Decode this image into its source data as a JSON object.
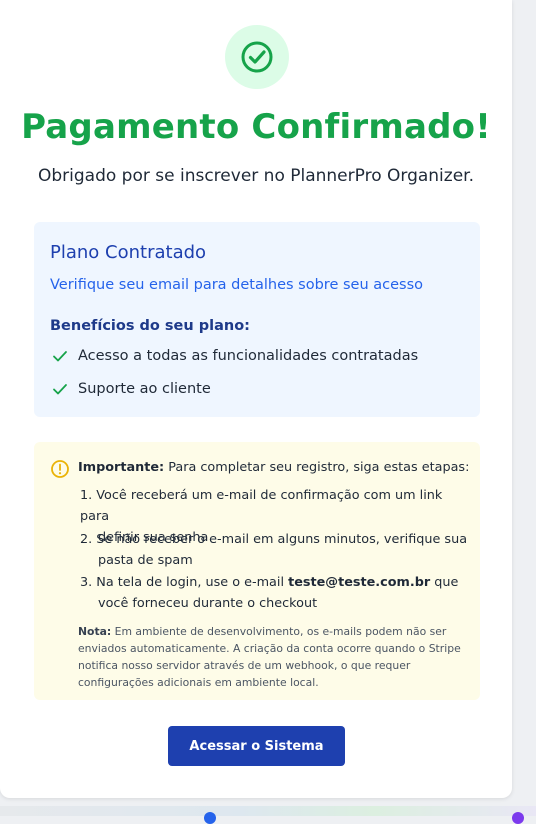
{
  "header": {
    "title": "Pagamento Confirmado!",
    "subtitle": "Obrigado por se inscrever no PlannerPro Organizer."
  },
  "plan": {
    "title": "Plano Contratado",
    "description": "Verifique seu email para detalhes sobre seu acesso",
    "benefits_heading": "Benefícios do seu plano:",
    "benefits": [
      "Acesso a todas as funcionalidades contratadas",
      "Suporte ao cliente"
    ]
  },
  "important": {
    "label": "Importante:",
    "intro": "Para completar seu registro, siga estas etapas:",
    "steps": [
      {
        "line1": "1. Você receberá um e-mail de confirmação com um link para",
        "line2": "definir sua senha"
      },
      {
        "line1": "2. Se não receber o e-mail em alguns minutos, verifique sua",
        "line2": "pasta de spam"
      },
      {
        "line1_pre": "3. Na tela de login, use o e-mail ",
        "email": "teste@teste.com.br",
        "line1_post": " que",
        "line2": "você forneceu durante o checkout"
      }
    ],
    "note_label": "Nota:",
    "note_lines": [
      "Em ambiente de desenvolvimento, os e-mails podem não ser",
      "enviados automaticamente. A criação da conta ocorre quando o Stripe",
      "notifica nosso servidor através de um webhook, o que requer",
      "configurações adicionais em ambiente local."
    ]
  },
  "action": {
    "button_label": "Acessar o Sistema"
  },
  "colors": {
    "success": "#16a34a",
    "success_bg": "#dcfce7",
    "plan_bg": "#eff6ff",
    "plan_title": "#1e40af",
    "warning_bg": "#fefce8",
    "warning_icon": "#eab308",
    "button": "#1e40af"
  },
  "icons": {
    "status": "check-circle-icon",
    "benefit": "check-icon",
    "warning": "exclamation-circle-icon"
  }
}
